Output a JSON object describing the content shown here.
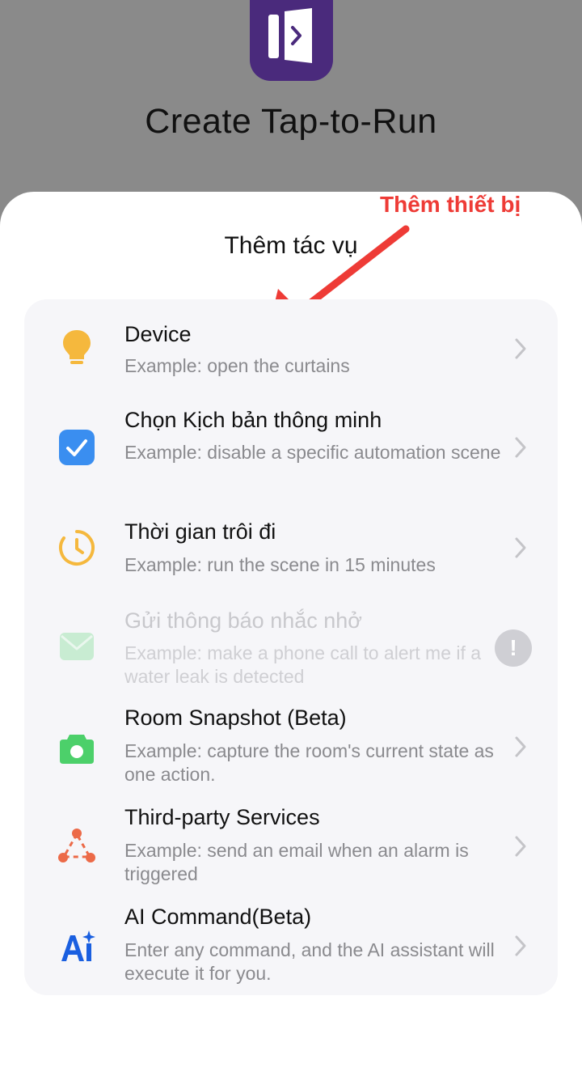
{
  "background": {
    "title": "Create Tap-to-Run"
  },
  "sheet": {
    "title": "Thêm tác vụ",
    "annotation": "Thêm thiết bị"
  },
  "actions": [
    {
      "title": "Device",
      "desc": "Example: open the curtains",
      "icon": "lightbulb-icon",
      "enabled": true
    },
    {
      "title": "Chọn Kịch bản thông minh",
      "desc": "Example: disable a specific automation scene",
      "icon": "checkbox-icon",
      "enabled": true
    },
    {
      "title": "Thời gian trôi đi",
      "desc": "Example: run the scene in 15 minutes",
      "icon": "timer-icon",
      "enabled": true
    },
    {
      "title": "Gửi thông báo nhắc nhở",
      "desc": "Example: make a phone call to alert me if a water leak is detected",
      "icon": "mail-icon",
      "enabled": false,
      "badge": "!"
    },
    {
      "title": "Room Snapshot (Beta)",
      "desc": "Example: capture the room's current state as one action.",
      "icon": "camera-icon",
      "enabled": true
    },
    {
      "title": "Third-party Services",
      "desc": "Example: send an email when an alarm is triggered",
      "icon": "share-nodes-icon",
      "enabled": true
    },
    {
      "title": "AI Command(Beta)",
      "desc": "Enter any command, and the AI assistant will execute it for you.",
      "icon": "ai-icon",
      "enabled": true
    }
  ],
  "colors": {
    "annotation": "#ee3b36",
    "logo": "#4a2a7c",
    "bulb": "#f5b83d",
    "checkbox": "#3a8ef0",
    "timer": "#f5b83d",
    "camera": "#4cd06a",
    "share": "#ec6a48",
    "ai": "#1a5fe0"
  }
}
